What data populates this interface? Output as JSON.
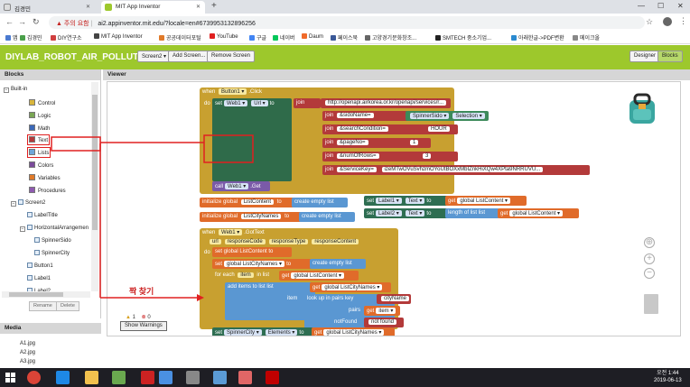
{
  "browser": {
    "tab_inactive": "김경민",
    "tab_active": "MIT App Inventor",
    "url_warning": "주의 요함",
    "url": "ai2.appinventor.mit.edu/?locale=en#6739953132896256",
    "bookmarks": [
      "앱",
      "김경민",
      "DIY연구소",
      "MIT App Inventor",
      "공공데이터포털",
      "YouTube",
      "구글",
      "네이버",
      "Daum",
      "페이스북",
      "고양경기문화창조...",
      "SMTECH 중소기업...",
      "아래한글->PDF변환",
      "메이크올"
    ]
  },
  "header": {
    "project_name": "DIYLAB_ROBOT_AIR_POLLUTION1",
    "screen_select": "Screen2 ▾",
    "add_screen": "Add Screen...",
    "remove_screen": "Remove Screen",
    "designer": "Designer",
    "blocks": "Blocks"
  },
  "blocks_panel": {
    "title": "Blocks",
    "builtin": "Built-in",
    "categories": [
      {
        "label": "Control",
        "color": "#d8b53c"
      },
      {
        "label": "Logic",
        "color": "#7aa654"
      },
      {
        "label": "Math",
        "color": "#3c69b8"
      },
      {
        "label": "Text",
        "color": "#b33a3a"
      },
      {
        "label": "Lists",
        "color": "#6fa6d9"
      },
      {
        "label": "Colors",
        "color": "#7a4a9a"
      },
      {
        "label": "Variables",
        "color": "#e07a2a"
      },
      {
        "label": "Procedures",
        "color": "#8e5ab0"
      }
    ],
    "screen": "Screen2",
    "components": [
      "LabelTitle",
      "HorizontalArrangemen",
      "SpinnerSido",
      "SpinnerCity",
      "Button1",
      "Label1",
      "Label2"
    ],
    "rename": "Rename",
    "delete": "Delete"
  },
  "media": {
    "title": "Media",
    "files": [
      "A1.jpg",
      "A2.jpg",
      "A3.jpg"
    ]
  },
  "viewer": {
    "title": "Viewer",
    "warnings_count": "1",
    "errors_count": "0",
    "show_warnings": "Show Warnings",
    "annotation": "짝 찾기"
  },
  "code": {
    "when": "when",
    "do": "do",
    "button1": "Button1 ▾",
    "click": ".Click",
    "set": "set",
    "web1": "Web1 ▾",
    "url_prop": "Url ▾",
    "to": "to",
    "join": "join",
    "url_text": "http://openapi.airkorea.or.kr/openapi/services/r...",
    "sido_name": "&sidoName=",
    "spinner_sido": "SpinnerSido ▾",
    "selection": "Selection ▾",
    "search_condition": "&searchCondition=",
    "hour": "HOUR",
    "page_no": "&pageNo=",
    "one": "1",
    "num_of_rows": "&numOfRows=",
    "three": "3",
    "service_key": "&ServiceKey=",
    "service_key_value": "izeMTwOVuSvhzmOYoUtBOXxMbIZnkHiXQw4XPta9NRRUVU...",
    "call": "call",
    "get_method": ".Get",
    "init_global": "initialize global",
    "list_content": "ListContent",
    "list_city_names": "ListCityNames",
    "create_empty_list": "create empty list",
    "label1": "Label1 ▾",
    "label2": "Label2 ▾",
    "text_prop": "Text ▾",
    "get": "get",
    "global_list_content": "global ListContent ▾",
    "length_of_list": "length of list list",
    "got_text": ".GotText",
    "url_param": "url",
    "response_code": "responseCode",
    "response_type": "responseType",
    "response_content": "responseContent",
    "set_global_list_content": "set global ListContent to",
    "set_global_city_names": "global ListCityNames ▾",
    "for_each": "for each",
    "item": "item",
    "in_list": "in list",
    "add_items": "add items to list",
    "list": "list",
    "global_list_city_names": "global ListCityNames ▾",
    "lookup_pairs": "look up in pairs  key",
    "city_name": "cityName",
    "pairs": "pairs",
    "item_get": "item ▾",
    "not_found_label": "notFound",
    "not_found_value": "not found",
    "spinner_city": "SpinnerCity ▾",
    "elements": "Elements ▾"
  },
  "taskbar": {
    "time": "오전 1:44",
    "date": "2019-06-13"
  }
}
